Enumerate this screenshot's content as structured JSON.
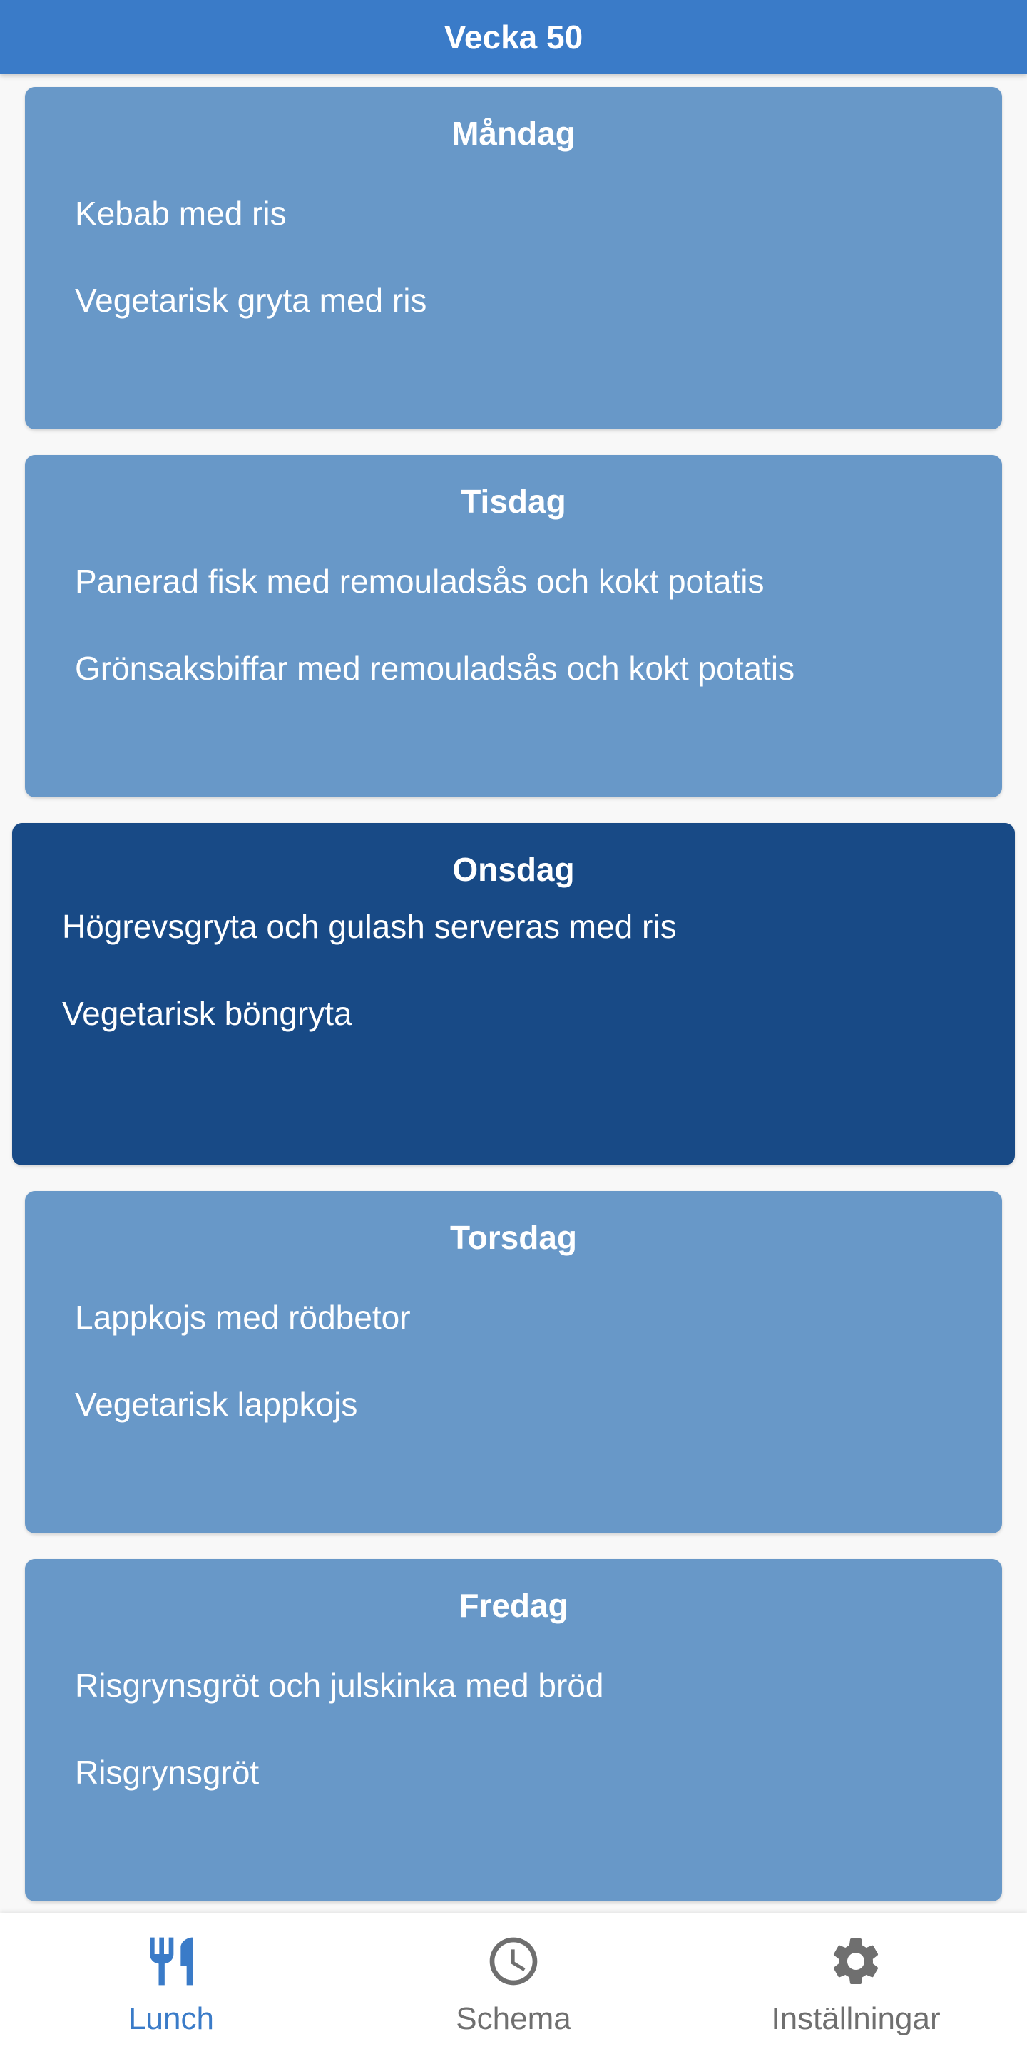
{
  "header": {
    "title": "Vecka 50"
  },
  "days": [
    {
      "name": "Måndag",
      "dishes": [
        "Kebab med ris",
        "Vegetarisk gryta med ris"
      ]
    },
    {
      "name": "Tisdag",
      "dishes": [
        "Panerad fisk med remouladsås och kokt potatis",
        "Grönsaksbiffar med remouladsås och kokt potatis"
      ]
    },
    {
      "name": "Onsdag",
      "dishes": [
        "Högrevsgryta och gulash serveras med ris",
        "Vegetarisk böngryta"
      ]
    },
    {
      "name": "Torsdag",
      "dishes": [
        "Lappkojs med rödbetor",
        "Vegetarisk lappkojs"
      ]
    },
    {
      "name": "Fredag",
      "dishes": [
        "Risgrynsgröt och julskinka med bröd",
        "Risgrynsgröt"
      ]
    }
  ],
  "nav": {
    "items": [
      {
        "label": "Lunch",
        "icon": "cutlery-icon"
      },
      {
        "label": "Schema",
        "icon": "clock-icon"
      },
      {
        "label": "Inställningar",
        "icon": "gear-icon"
      }
    ]
  },
  "colors": {
    "primary": "#3a7bc8",
    "card": "#6898c8",
    "card_active": "#184a86",
    "inactive_nav": "#6f6f6f"
  }
}
